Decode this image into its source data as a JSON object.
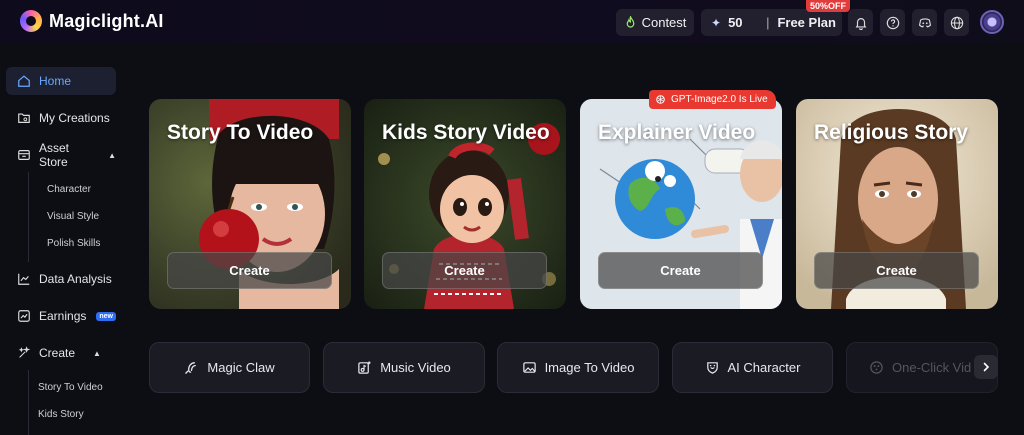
{
  "app": {
    "name": "Magiclight.AI"
  },
  "topbar": {
    "contest_label": "Contest",
    "credits": "50",
    "plan_label": "Free Plan",
    "discount_badge": "50%OFF"
  },
  "sidebar": {
    "home": "Home",
    "my_creations": "My Creations",
    "asset_store": "Asset Store",
    "asset_sub": [
      "Character",
      "Visual Style",
      "Polish Skills"
    ],
    "data_analysis": "Data Analysis",
    "earnings": "Earnings",
    "earnings_badge": "new",
    "create": "Create",
    "create_sub": [
      "Story To Video",
      "Kids Story"
    ]
  },
  "cards": [
    {
      "title": "Story To Video",
      "button": "Create"
    },
    {
      "title": "Kids Story Video",
      "button": "Create"
    },
    {
      "title": "Explainer Video",
      "button": "Create",
      "badge": "GPT-Image2.0 Is Live"
    },
    {
      "title": "Religious Story",
      "button": "Create"
    }
  ],
  "tools": [
    "Magic Claw",
    "Music Video",
    "Image To Video",
    "AI Character",
    "One-Click Vid"
  ],
  "colors": {
    "accent": "#6aa7ff",
    "badge_red": "#e8382f",
    "new_badge": "#2d6ef5"
  }
}
